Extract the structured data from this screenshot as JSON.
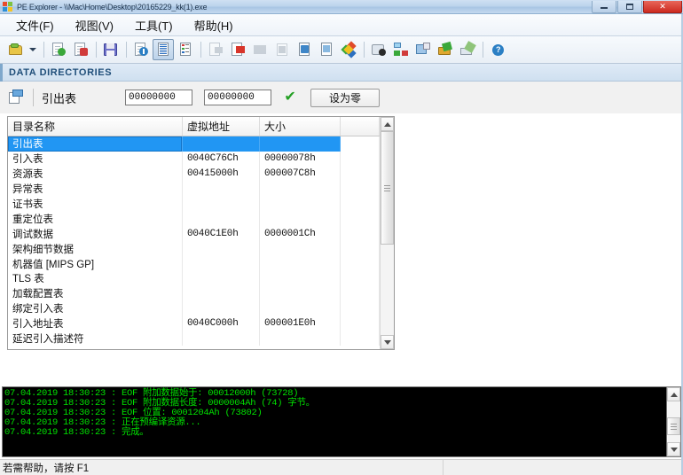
{
  "window": {
    "title": "PE Explorer - \\\\Mac\\Home\\Desktop\\20165229_kk(1).exe",
    "app_icon": "pe-explorer-icon",
    "minimize_label": "",
    "maximize_label": "",
    "close_label": "✕"
  },
  "menubar": {
    "items": [
      {
        "label": "文件(F)",
        "name": "menu-file"
      },
      {
        "label": "视图(V)",
        "name": "menu-view"
      },
      {
        "label": "工具(T)",
        "name": "menu-tools"
      },
      {
        "label": "帮助(H)",
        "name": "menu-help"
      }
    ]
  },
  "toolbar": {
    "icons": [
      "open-file-icon",
      "open-dropdown-arrow",
      "refresh-icon",
      "close-file-icon",
      "save-icon",
      "header-info-icon",
      "data-directories-icon",
      "section-headers-icon",
      "export-icon",
      "import-icon",
      "resources-icon",
      "delay-import-icon",
      "relocations-icon",
      "debug-icon",
      "color-wheel-icon",
      "disassembler-icon",
      "dependency-scanner-icon",
      "quick-view-icon",
      "resource-editor-icon",
      "signature-scanner-icon",
      "help-icon"
    ]
  },
  "section": {
    "title": "DATA DIRECTORIES",
    "accent_color": "#1f4e79"
  },
  "editor": {
    "icon": "directory-goto-icon",
    "label": "引出表",
    "virtual_address_value": "00000000",
    "size_value": "00000000",
    "valid_icon": "green-check-icon",
    "zero_button_label": "设为零"
  },
  "table": {
    "columns": [
      "目录名称",
      "虚拟地址",
      "大小",
      ""
    ],
    "rows": [
      {
        "name": "引出表",
        "va": "",
        "size": "",
        "selected": true
      },
      {
        "name": "引入表",
        "va": "0040C76Ch",
        "size": "00000078h",
        "selected": false
      },
      {
        "name": "资源表",
        "va": "00415000h",
        "size": "000007C8h",
        "selected": false
      },
      {
        "name": "异常表",
        "va": "",
        "size": "",
        "selected": false
      },
      {
        "name": "证书表",
        "va": "",
        "size": "",
        "selected": false
      },
      {
        "name": "重定位表",
        "va": "",
        "size": "",
        "selected": false
      },
      {
        "name": "调试数据",
        "va": "0040C1E0h",
        "size": "0000001Ch",
        "selected": false
      },
      {
        "name": "架构细节数据",
        "va": "",
        "size": "",
        "selected": false
      },
      {
        "name": "机器值 [MIPS GP]",
        "va": "",
        "size": "",
        "selected": false
      },
      {
        "name": "TLS 表",
        "va": "",
        "size": "",
        "selected": false
      },
      {
        "name": "加载配置表",
        "va": "",
        "size": "",
        "selected": false
      },
      {
        "name": "绑定引入表",
        "va": "",
        "size": "",
        "selected": false
      },
      {
        "name": "引入地址表",
        "va": "0040C000h",
        "size": "000001E0h",
        "selected": false
      },
      {
        "name": "延迟引入描述符",
        "va": "",
        "size": "",
        "selected": false
      }
    ]
  },
  "console": {
    "text_color": "#00e000",
    "background": "#000000",
    "lines": [
      "07.04.2019 18:30:23 : EOF 附加数据始于: 00012000h  (73728)",
      "07.04.2019 18:30:23 : EOF 附加数据长度: 0000004Ah  (74) 字节。",
      "07.04.2019 18:30:23 : EOF 位置: 0001204Ah  (73802)",
      "07.04.2019 18:30:23 : 正在预编译资源...",
      "07.04.2019 18:30:23 : 完成。"
    ]
  },
  "statusbar": {
    "hint": "若需帮助，请按 F1",
    "right_text": ""
  }
}
